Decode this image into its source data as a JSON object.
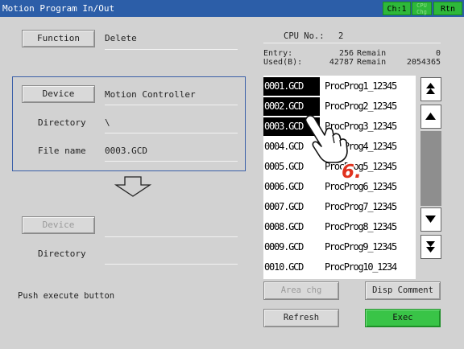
{
  "titlebar": {
    "title": "Motion Program In/Out",
    "ch_label": "Ch:1",
    "cpu_chg_label": "CPU Chg",
    "rtn_label": "Rtn"
  },
  "function": {
    "button_label": "Function",
    "value": "Delete"
  },
  "source": {
    "device_button": "Device",
    "device_value": "Motion Controller",
    "directory_label": "Directory",
    "directory_value": "\\",
    "filename_label": "File name",
    "filename_value": "0003.GCD"
  },
  "dest": {
    "device_button": "Device",
    "device_value": "",
    "directory_label": "Directory",
    "directory_value": ""
  },
  "cpu": {
    "label": "CPU No.:",
    "value": "2"
  },
  "stats": {
    "entry_label": "Entry:",
    "entry_count": "256",
    "entry_remain_label": "Remain",
    "entry_remain": "0",
    "used_label": "Used(B):",
    "used_count": "42787",
    "used_remain_label": "Remain",
    "used_remain": "2054365"
  },
  "files": [
    {
      "file": "0001.GCD",
      "prog": "ProcProg1_12345",
      "selected": true
    },
    {
      "file": "0002.GCD",
      "prog": "ProcProg2_12345",
      "selected": true
    },
    {
      "file": "0003.GCD",
      "prog": "ProcProg3_12345",
      "selected": true
    },
    {
      "file": "0004.GCD",
      "prog": "ProcProg4_12345",
      "selected": false
    },
    {
      "file": "0005.GCD",
      "prog": "ProcProg5_12345",
      "selected": false
    },
    {
      "file": "0006.GCD",
      "prog": "ProcProg6_12345",
      "selected": false
    },
    {
      "file": "0007.GCD",
      "prog": "ProcProg7_12345",
      "selected": false
    },
    {
      "file": "0008.GCD",
      "prog": "ProcProg8_12345",
      "selected": false
    },
    {
      "file": "0009.GCD",
      "prog": "ProcProg9_12345",
      "selected": false
    },
    {
      "file": "0010.GCD",
      "prog": "ProcProg10_1234",
      "selected": false
    }
  ],
  "status_message": "Push execute button",
  "buttons": {
    "area_chg": "Area chg",
    "disp_comment": "Disp Comment",
    "refresh": "Refresh",
    "exec": "Exec"
  },
  "annotation": {
    "step": "6."
  },
  "colors": {
    "title_bar": "#2c5ea8",
    "accent_green": "#39c447",
    "annotation_red": "#e0321e",
    "frame_blue": "#3a5fa8"
  }
}
